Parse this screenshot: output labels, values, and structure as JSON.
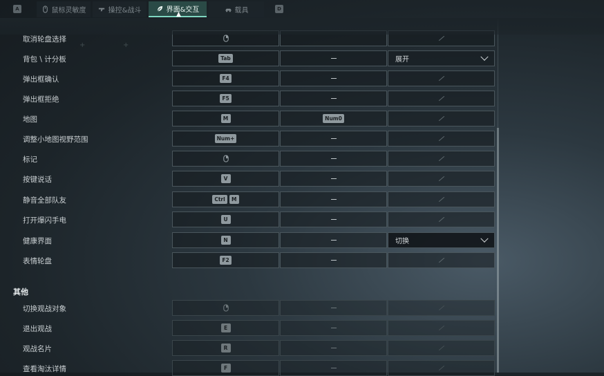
{
  "tabs": {
    "left_key": "A",
    "right_key": "D",
    "items": [
      {
        "label": "鼠标灵敏度",
        "icon": "mouse-icon"
      },
      {
        "label": "操控&战斗",
        "icon": "gun-icon"
      },
      {
        "label": "界面&交互",
        "icon": "leaf-icon",
        "active": true
      },
      {
        "label": "载具",
        "icon": "vehicle-icon"
      }
    ]
  },
  "rows": [
    {
      "label": "取消轮盘选择",
      "key1": [
        "mouse"
      ],
      "key2": "",
      "extra": "slash"
    },
    {
      "label": "背包 \\ 计分板",
      "key1": [
        "Tab"
      ],
      "key2": "—",
      "extra": "dropdown",
      "dropdown": "展开"
    },
    {
      "label": "弹出框确认",
      "key1": [
        "F4"
      ],
      "key2": "—",
      "extra": "slash"
    },
    {
      "label": "弹出框拒绝",
      "key1": [
        "F5"
      ],
      "key2": "—",
      "extra": "slash"
    },
    {
      "label": "地图",
      "key1": [
        "M"
      ],
      "key2": "Num0",
      "extra": "slash"
    },
    {
      "label": "调整小地图视野范围",
      "key1": [
        "Num+"
      ],
      "key2": "—",
      "extra": "slash"
    },
    {
      "label": "标记",
      "key1": [
        "mouse"
      ],
      "key2": "—",
      "extra": "slash"
    },
    {
      "label": "按键说话",
      "key1": [
        "V"
      ],
      "key2": "—",
      "extra": "slash"
    },
    {
      "label": "静音全部队友",
      "key1": [
        "Ctrl",
        "M"
      ],
      "key2": "—",
      "extra": "slash"
    },
    {
      "label": "打开爆闪手电",
      "key1": [
        "U"
      ],
      "key2": "—",
      "extra": "slash"
    },
    {
      "label": "健康界面",
      "key1": [
        "N"
      ],
      "key2": "—",
      "extra": "dropdown",
      "dropdown": "切换"
    },
    {
      "label": "表情轮盘",
      "key1": [
        "F2"
      ],
      "key2": "—",
      "extra": "slash"
    }
  ],
  "section_other": "其他",
  "other_rows": [
    {
      "label": "切换观战对象",
      "key1": [
        "mouse"
      ],
      "key2": "—"
    },
    {
      "label": "退出观战",
      "key1": [
        "E"
      ],
      "key2": "—"
    },
    {
      "label": "观战名片",
      "key1": [
        "R"
      ],
      "key2": "—"
    },
    {
      "label": "查看淘汰详情",
      "key1": [
        "F"
      ],
      "key2": "—"
    }
  ]
}
